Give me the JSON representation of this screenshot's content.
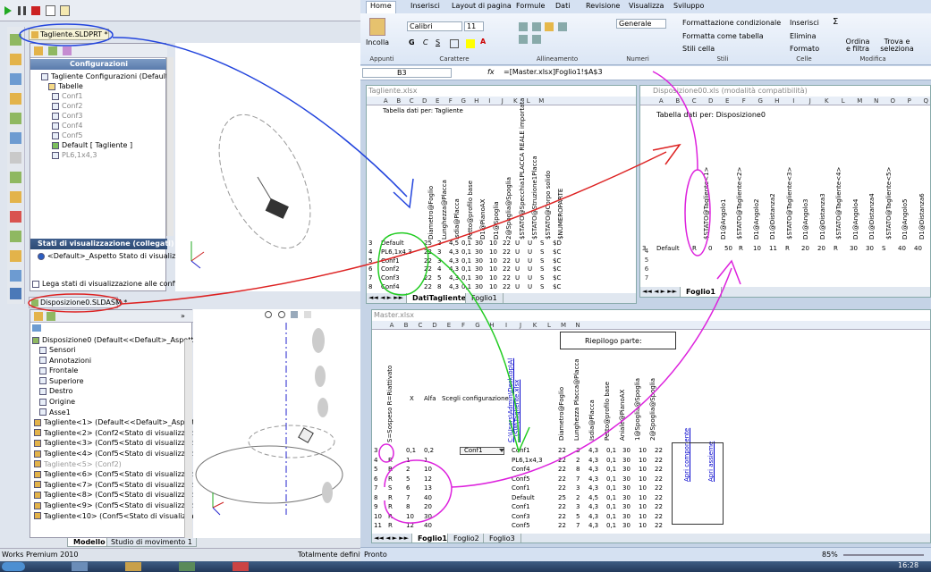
{
  "solidworks": {
    "part_tab": "Tagliente.SLDPRT *",
    "config_header": "Configurazioni",
    "config_tree": {
      "root": "Tagliente Configurazioni  (Default)",
      "tables": "Tabelle",
      "items": [
        "Conf1",
        "Conf2",
        "Conf3",
        "Conf4",
        "Conf5",
        "Default [ Tagliente ]",
        "PL6,1x4,3"
      ]
    },
    "display_states_header": "Stati di visualizzazione (collegati)",
    "display_state_item": "<Default>_Aspetto Stato di visualizzaz",
    "link_states_label": "Lega stati di visualizzazione alle configurazi",
    "asm_tab": "Disposizione0.SLDASM *",
    "asm_tree": {
      "root": "Disposizione0  (Default<<Default>_Aspetto Stat",
      "items": [
        "Sensori",
        "Annotazioni",
        "Frontale",
        "Superiore",
        "Destro",
        "Origine",
        "Asse1",
        "Tagliente<1> (Default<<Default>_Aspetto S",
        "Tagliente<2> (Conf2<Stato di visualizzazion",
        "Tagliente<3> (Conf5<Stato di visualizzazion",
        "Tagliente<4> (Conf5<Stato di visualizzazion",
        "Tagliente<5> (Conf2)",
        "Tagliente<6> (Conf5<Stato di visualizzazion",
        "Tagliente<7> (Conf5<Stato di visualizzazion",
        "Tagliente<8> (Conf5<Stato di visualizzazion",
        "Tagliente<9> (Conf5<Stato di visualizzazion",
        "Tagliente<10> (Conf5<Stato di visualizzazio"
      ]
    },
    "bottom_tabs": [
      "Modello",
      "Studio di movimento 1"
    ],
    "status_left": "Works Premium 2010",
    "status_right": "Totalmente definito"
  },
  "excel": {
    "ribbon_tabs": [
      "Home",
      "Inserisci",
      "Layout di pagina",
      "Formule",
      "Dati",
      "Revisione",
      "Visualizza",
      "Sviluppo"
    ],
    "paste_label": "Incolla",
    "font_name": "Calibri",
    "font_size": "11",
    "number_format": "Generale",
    "ribbon_buttons": {
      "conditional": "Formattazione condizionale",
      "table": "Formatta come tabella",
      "styles": "Stili cella",
      "insert": "Inserisci",
      "delete": "Elimina",
      "format": "Formato",
      "sort": "Ordina e filtra",
      "find": "Trova e seleziona"
    },
    "groups": [
      "Appunti",
      "Carattere",
      "Allineamento",
      "Numeri",
      "Stili",
      "Celle",
      "Modifica"
    ],
    "name_box": "B3",
    "formula": "=[Master.xlsx]Foglio1!$A$3",
    "wb1": {
      "title": "Tagliente.xlsx",
      "cols": [
        "A",
        "B",
        "C",
        "D",
        "E",
        "F",
        "G",
        "H",
        "I",
        "J",
        "K",
        "L",
        "M"
      ],
      "a1": "Tabella dati per: Tagliente",
      "headers": [
        "Diametro@Foglio",
        "Lunghezza@Placca",
        "Isdia@Placca",
        "Petto@profilo base",
        "D1@PianoAX",
        "D1@Spoglia",
        "2@Spoglia@Spoglia",
        "$STATO@Specchia1PLACCA REALE importata",
        "$STATO@Struzione1Placca",
        "$STATO@Corpo solido",
        "$NUMEROPARTE"
      ],
      "rows": [
        [
          "3",
          "Default",
          "25",
          "2",
          "4,5",
          "0,1",
          "30",
          "10",
          "22",
          "U",
          "U",
          "S",
          "$D"
        ],
        [
          "4",
          "PL6,1x4,3",
          "22",
          "3",
          "4,3",
          "0,1",
          "30",
          "10",
          "22",
          "U",
          "U",
          "S",
          "$C"
        ],
        [
          "5",
          "Conf1",
          "22",
          "3",
          "4,3",
          "0,1",
          "30",
          "10",
          "22",
          "U",
          "U",
          "S",
          "$C"
        ],
        [
          "6",
          "Conf2",
          "22",
          "4",
          "4,3",
          "0,1",
          "30",
          "10",
          "22",
          "U",
          "U",
          "S",
          "$C"
        ],
        [
          "7",
          "Conf3",
          "22",
          "5",
          "4,3",
          "0,1",
          "30",
          "10",
          "22",
          "U",
          "U",
          "S",
          "$C"
        ],
        [
          "8",
          "Conf4",
          "22",
          "8",
          "4,3",
          "0,1",
          "30",
          "10",
          "22",
          "U",
          "U",
          "S",
          "$C"
        ]
      ],
      "tabs": [
        "DatiTagliente",
        "Foglio1"
      ]
    },
    "wb2": {
      "title": "Disposizione00.xls  (modalità compatibilità)",
      "cols": [
        "A",
        "B",
        "C",
        "D",
        "E",
        "F",
        "G",
        "H",
        "I",
        "J",
        "K",
        "L",
        "M",
        "N",
        "O",
        "P",
        "Q"
      ],
      "a1": "Tabella dati per: Disposizione0",
      "headers": [
        "$STATO@Tagliente<1>",
        "D1@Angolo1",
        "$STATO@Tagliente<2>",
        "D1@Angolo2",
        "D1@Distanza2",
        "$STATO@Tagliente<3>",
        "D1@Angolo3",
        "D1@Distanza3",
        "$STATO@Tagliente<4>",
        "D1@Angolo4",
        "D1@Distanza4",
        "$STATO@Tagliente<5>",
        "D1@Angolo5",
        "D1@Distanza6"
      ],
      "row3": [
        "3",
        "Default",
        "R",
        "0",
        "50",
        "R",
        "10",
        "11",
        "R",
        "20",
        "20",
        "R",
        "30",
        "30",
        "S",
        "40",
        "40"
      ],
      "tabs": [
        "Foglio1"
      ]
    },
    "wb3": {
      "title": "Master.xlsx",
      "cols": [
        "A",
        "B",
        "C",
        "D",
        "E",
        "F",
        "G",
        "H",
        "I",
        "J",
        "K",
        "L",
        "M",
        "N"
      ],
      "summary": "Riepilogo parte:",
      "header_a": "S=Sospeso R=Riattivato",
      "header_b": "X",
      "header_c": "Alfa",
      "header_d": "Scegli configurazione",
      "header_e": "C:\\Users\\Admin\\Desktop\\Al ...\\SW\\Tagliente.xlsx",
      "part_headers": [
        "Diametro@Foglio",
        "Lunghezza Placca@Placca",
        "Isdia@Placca",
        "Petto@profilo base",
        "Aniale@PianoAX",
        "1@Spoglia@Spoglia",
        "2@Spoglia@Spoglia"
      ],
      "open_comp": "Apri componente",
      "open_asm": "Apri assieme",
      "dropdown": "Conf1",
      "rows": [
        [
          "3",
          "",
          "0,1",
          "0,2",
          "",
          "Conf1",
          "22",
          "3",
          "4,3",
          "0,1",
          "30",
          "10",
          "22"
        ],
        [
          "4",
          "R",
          "1",
          "1",
          "",
          "PL6,1x4,3",
          "22",
          "2",
          "4,3",
          "0,1",
          "30",
          "10",
          "22"
        ],
        [
          "5",
          "R",
          "2",
          "10",
          "",
          "Conf4",
          "22",
          "8",
          "4,3",
          "0,1",
          "30",
          "10",
          "22"
        ],
        [
          "6",
          "R",
          "5",
          "12",
          "",
          "Conf5",
          "22",
          "7",
          "4,3",
          "0,1",
          "30",
          "10",
          "22"
        ],
        [
          "7",
          "S",
          "6",
          "13",
          "",
          "Conf1",
          "22",
          "3",
          "4,3",
          "0,1",
          "30",
          "10",
          "22"
        ],
        [
          "8",
          "R",
          "7",
          "40",
          "",
          "Default",
          "25",
          "2",
          "4,5",
          "0,1",
          "30",
          "10",
          "22"
        ],
        [
          "9",
          "R",
          "8",
          "20",
          "",
          "Conf1",
          "22",
          "3",
          "4,3",
          "0,1",
          "30",
          "10",
          "22"
        ],
        [
          "10",
          "R",
          "10",
          "30",
          "",
          "Conf3",
          "22",
          "5",
          "4,3",
          "0,1",
          "30",
          "10",
          "22"
        ],
        [
          "11",
          "R",
          "12",
          "40",
          "",
          "Conf5",
          "22",
          "7",
          "4,3",
          "0,1",
          "30",
          "10",
          "22"
        ]
      ],
      "tabs": [
        "Foglio1",
        "Foglio2",
        "Foglio3"
      ]
    },
    "status_ready": "Pronto",
    "zoom": "85%"
  },
  "taskbar": {
    "clock": "16:28"
  }
}
